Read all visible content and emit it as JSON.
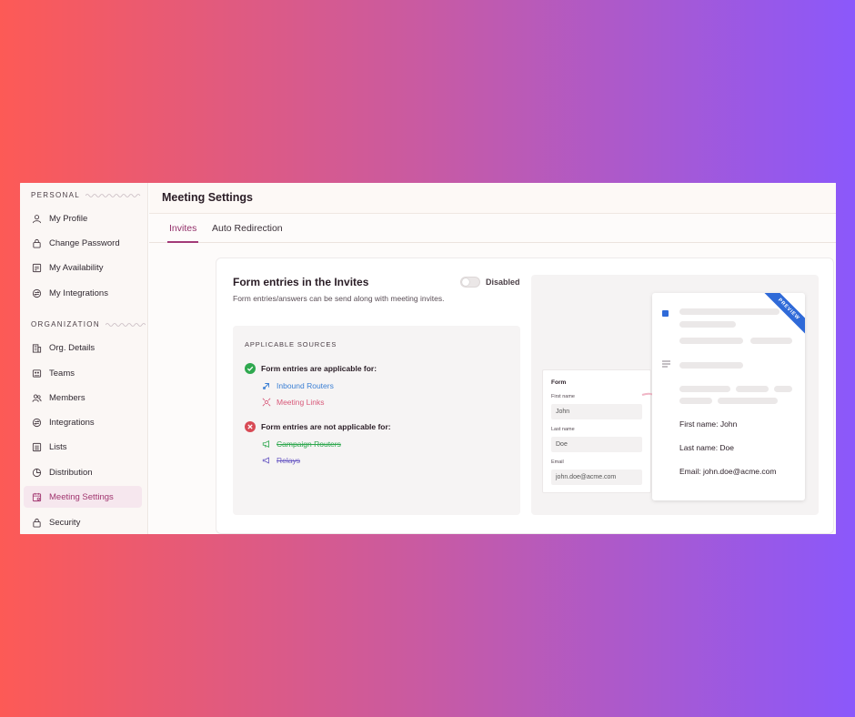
{
  "sidebar": {
    "personal_heading": "PERSONAL",
    "personal_items": [
      {
        "label": "My Profile",
        "icon": "user-icon"
      },
      {
        "label": "Change Password",
        "icon": "lock-icon"
      },
      {
        "label": "My Availability",
        "icon": "calendar-icon"
      },
      {
        "label": "My Integrations",
        "icon": "integration-icon"
      }
    ],
    "organization_heading": "ORGANIZATION",
    "organization_items": [
      {
        "label": "Org. Details",
        "icon": "building-icon"
      },
      {
        "label": "Teams",
        "icon": "teams-icon"
      },
      {
        "label": "Members",
        "icon": "members-icon"
      },
      {
        "label": "Integrations",
        "icon": "integration-icon"
      },
      {
        "label": "Lists",
        "icon": "list-icon"
      },
      {
        "label": "Distribution",
        "icon": "pie-icon"
      },
      {
        "label": "Meeting Settings",
        "icon": "meeting-settings-icon",
        "active": true
      },
      {
        "label": "Security",
        "icon": "lock-icon"
      }
    ]
  },
  "header": {
    "title": "Meeting Settings"
  },
  "tabs": [
    {
      "label": "Invites",
      "active": true
    },
    {
      "label": "Auto Redirection",
      "active": false
    }
  ],
  "card": {
    "title": "Form entries in the Invites",
    "description": "Form entries/answers can be send along with meeting invites.",
    "toggle_label": "Disabled",
    "toggle_on": false,
    "sources": {
      "heading": "APPLICABLE SOURCES",
      "applicable_title": "Form entries are applicable for:",
      "applicable": [
        {
          "label": "Inbound Routers",
          "color": "#3b7fd4",
          "icon": "router-icon"
        },
        {
          "label": "Meeting Links",
          "color": "#d85a7a",
          "icon": "link-icon"
        }
      ],
      "not_applicable_title": "Form entries are not applicable for:",
      "not_applicable": [
        {
          "label": "Campaign Routers",
          "color": "#2fa84f",
          "icon": "megaphone-icon"
        },
        {
          "label": "Relays",
          "color": "#6b5bc4",
          "icon": "relay-icon"
        }
      ]
    }
  },
  "preview": {
    "ribbon": "PREVIEW",
    "form": {
      "title": "Form",
      "fields": [
        {
          "label": "First name",
          "value": "John"
        },
        {
          "label": "Last name",
          "value": "Doe"
        },
        {
          "label": "Email",
          "value": "john.doe@acme.com"
        }
      ]
    },
    "invite_lines": [
      "First name:  John",
      "Last name: Doe",
      "Email: john.doe@acme.com"
    ]
  },
  "colors": {
    "accent": "#a1356f",
    "check": "#2fa84f",
    "cross": "#d84a55",
    "ribbon": "#2f6ad8"
  }
}
